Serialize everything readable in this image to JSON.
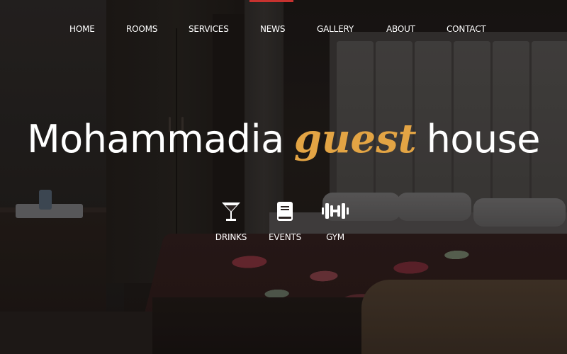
{
  "nav": {
    "items": [
      {
        "label": "HOME"
      },
      {
        "label": "ROOMS"
      },
      {
        "label": "SERVICES"
      },
      {
        "label": "NEWS"
      },
      {
        "label": "GALLERY"
      },
      {
        "label": "ABOUT"
      },
      {
        "label": "CONTACT"
      }
    ],
    "accent_color": "#c7322f"
  },
  "hero": {
    "title_part1": "Mohammadia",
    "title_accent": "guest",
    "title_part2": "house",
    "accent_color": "#e3a444"
  },
  "features": [
    {
      "icon": "cocktail-glass-icon",
      "label": "DRINKS"
    },
    {
      "icon": "book-icon",
      "label": "EVENTS"
    },
    {
      "icon": "dumbbell-icon",
      "label": "GYM"
    }
  ]
}
